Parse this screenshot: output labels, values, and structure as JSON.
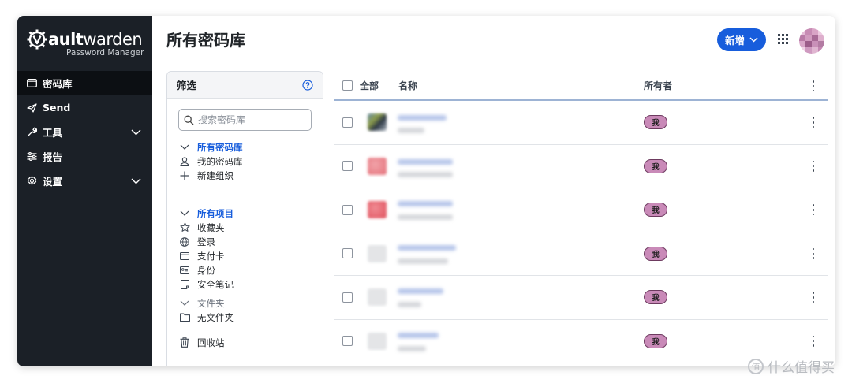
{
  "app": {
    "logo_text_bold": "V",
    "logo_text_rest": "ault",
    "logo_text_light": "warden",
    "logo_subtitle": "Password Manager"
  },
  "sidebar": {
    "items": [
      {
        "label": "密码库",
        "icon": "vault-icon",
        "active": true
      },
      {
        "label": "Send",
        "icon": "send-icon"
      },
      {
        "label": "工具",
        "icon": "wrench-icon",
        "has_submenu": true
      },
      {
        "label": "报告",
        "icon": "sliders-icon"
      },
      {
        "label": "设置",
        "icon": "gear-icon",
        "has_submenu": true
      }
    ]
  },
  "header": {
    "title": "所有密码库",
    "new_button_label": "新增",
    "apps_icon": "grid-icon"
  },
  "filter": {
    "title": "筛选",
    "search_placeholder": "搜索密码库",
    "vaults": [
      {
        "label": "所有密码库",
        "icon": "chevron-down-icon",
        "selected": true
      },
      {
        "label": "我的密码库",
        "icon": "user-icon"
      },
      {
        "label": "新建组织",
        "icon": "plus-icon"
      }
    ],
    "types_heading": "所有项目",
    "types": [
      {
        "label": "收藏夹",
        "icon": "star-icon"
      },
      {
        "label": "登录",
        "icon": "globe-icon"
      },
      {
        "label": "支付卡",
        "icon": "credit-card-icon"
      },
      {
        "label": "身份",
        "icon": "id-card-icon"
      },
      {
        "label": "安全笔记",
        "icon": "note-icon"
      }
    ],
    "folders_heading": "文件夹",
    "folders": [
      {
        "label": "无文件夹",
        "icon": "folder-icon"
      }
    ],
    "trash_label": "回收站"
  },
  "table": {
    "col_all": "全部",
    "col_name": "名称",
    "col_owner": "所有者",
    "rows": [
      {
        "owner": "我"
      },
      {
        "owner": "我"
      },
      {
        "owner": "我"
      },
      {
        "owner": "我"
      },
      {
        "owner": "我"
      },
      {
        "owner": "我"
      }
    ]
  },
  "watermark": {
    "text": "什么值得买",
    "badge": "值"
  },
  "colors": {
    "sidebar_bg": "#1b2027",
    "accent": "#175ddc",
    "owner_badge": "#c98ab8"
  }
}
